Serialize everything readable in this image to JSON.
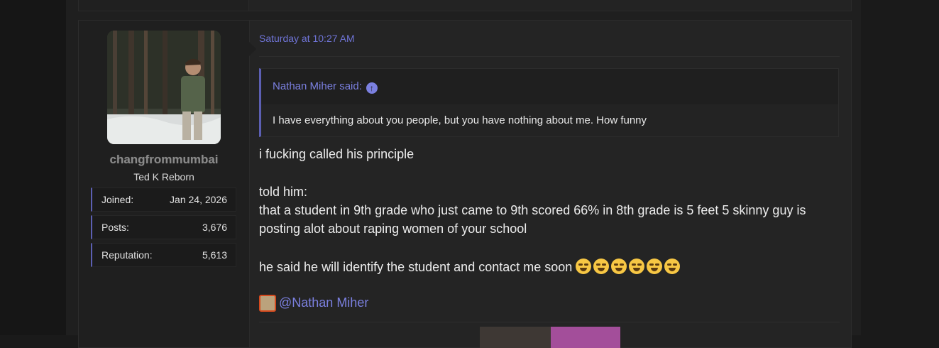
{
  "post": {
    "user": {
      "username": "changfrommumbai",
      "title": "Ted K Reborn",
      "stats": [
        {
          "label": "Joined:",
          "value": "Jan 24, 2026"
        },
        {
          "label": "Posts:",
          "value": "3,676"
        },
        {
          "label": "Reputation:",
          "value": "5,613"
        }
      ]
    },
    "date": "Saturday at 10:27 AM",
    "quote": {
      "author_line": "Nathan Miher said:",
      "text": "I have everything about you people, but you have nothing about me. How funny"
    },
    "body_lines": [
      "i fucking called his principle",
      "told him:",
      "that a student in 9th grade who just came to 9th scored 66% in 8th grade is 5 feet 5 skinny guy is",
      "posting alot about raping women of your school",
      "he said he will identify the student and contact me soon"
    ],
    "emoji_icon": "loudly-crying-face-icon",
    "emoji_count": 6,
    "mention": "@Nathan Miher"
  },
  "colors": {
    "accent": "#7b80e0",
    "quote_border": "#5c5fb3",
    "background": "#1a1a1a",
    "post_bg": "#242424"
  }
}
